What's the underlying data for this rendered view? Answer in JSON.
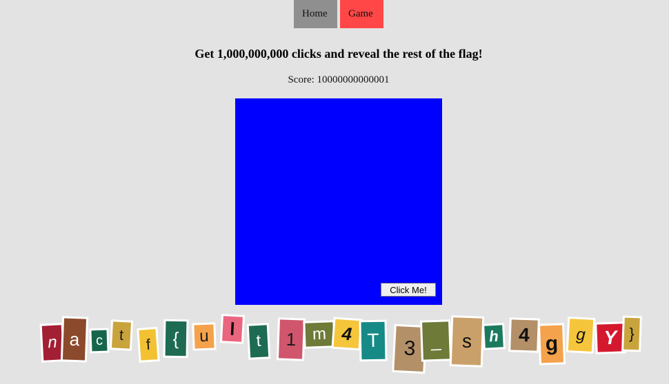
{
  "nav": {
    "home_label": "Home",
    "game_label": "Game",
    "home_bg": "#8f8f8f",
    "game_bg": "#ff4747"
  },
  "headline": "Get 1,000,000,000 clicks and reveal the rest of the flag!",
  "score_text": "Score: 10000000000001",
  "game": {
    "area_color": "#0000ff",
    "button_label": "Click Me!"
  },
  "flag_letters": [
    {
      "char": "n",
      "bg": "#a31f34",
      "fg": "#ffffff",
      "italic": true,
      "bold": false
    },
    {
      "char": "a",
      "bg": "#8b4a2b",
      "fg": "#ffffff",
      "italic": false,
      "bold": false
    },
    {
      "char": "c",
      "bg": "#16664a",
      "fg": "#ffffff",
      "italic": false,
      "bold": false
    },
    {
      "char": "t",
      "bg": "#c9a33c",
      "fg": "#1a1a1a",
      "italic": false,
      "bold": false
    },
    {
      "char": "f",
      "bg": "#f2c232",
      "fg": "#1a1a1a",
      "italic": false,
      "bold": false
    },
    {
      "char": "{",
      "bg": "#1d6b52",
      "fg": "#ffffff",
      "italic": false,
      "bold": false
    },
    {
      "char": "u",
      "bg": "#f4a24b",
      "fg": "#1a1a1a",
      "italic": false,
      "bold": false
    },
    {
      "char": "l",
      "bg": "#e9667e",
      "fg": "#111111",
      "italic": false,
      "bold": true
    },
    {
      "char": "t",
      "bg": "#1d6b52",
      "fg": "#ffffff",
      "italic": false,
      "bold": false
    },
    {
      "char": "1",
      "bg": "#d0566d",
      "fg": "#1a1a1a",
      "italic": false,
      "bold": false
    },
    {
      "char": "m",
      "bg": "#6e7a38",
      "fg": "#ffffff",
      "italic": false,
      "bold": false
    },
    {
      "char": "4",
      "bg": "#f5c53b",
      "fg": "#111111",
      "italic": true,
      "bold": true
    },
    {
      "char": "T",
      "bg": "#168a86",
      "fg": "#ffffff",
      "italic": false,
      "bold": false
    },
    {
      "char": "3",
      "bg": "#b39068",
      "fg": "#111111",
      "italic": false,
      "bold": false
    },
    {
      "char": "_",
      "bg": "#6e7a38",
      "fg": "#ffffff",
      "italic": false,
      "bold": false
    },
    {
      "char": "s",
      "bg": "#caa06a",
      "fg": "#111111",
      "italic": false,
      "bold": false
    },
    {
      "char": "h",
      "bg": "#1b7a5e",
      "fg": "#ffffff",
      "italic": true,
      "bold": true
    },
    {
      "char": "4",
      "bg": "#b39068",
      "fg": "#111111",
      "italic": false,
      "bold": true
    },
    {
      "char": "g",
      "bg": "#f4a24b",
      "fg": "#111111",
      "italic": false,
      "bold": true
    },
    {
      "char": "g",
      "bg": "#f5c53b",
      "fg": "#111111",
      "italic": true,
      "bold": false
    },
    {
      "char": "Y",
      "bg": "#d4192f",
      "fg": "#ffffff",
      "italic": true,
      "bold": true
    },
    {
      "char": "}",
      "bg": "#c9a33c",
      "fg": "#111111",
      "italic": false,
      "bold": false
    }
  ]
}
